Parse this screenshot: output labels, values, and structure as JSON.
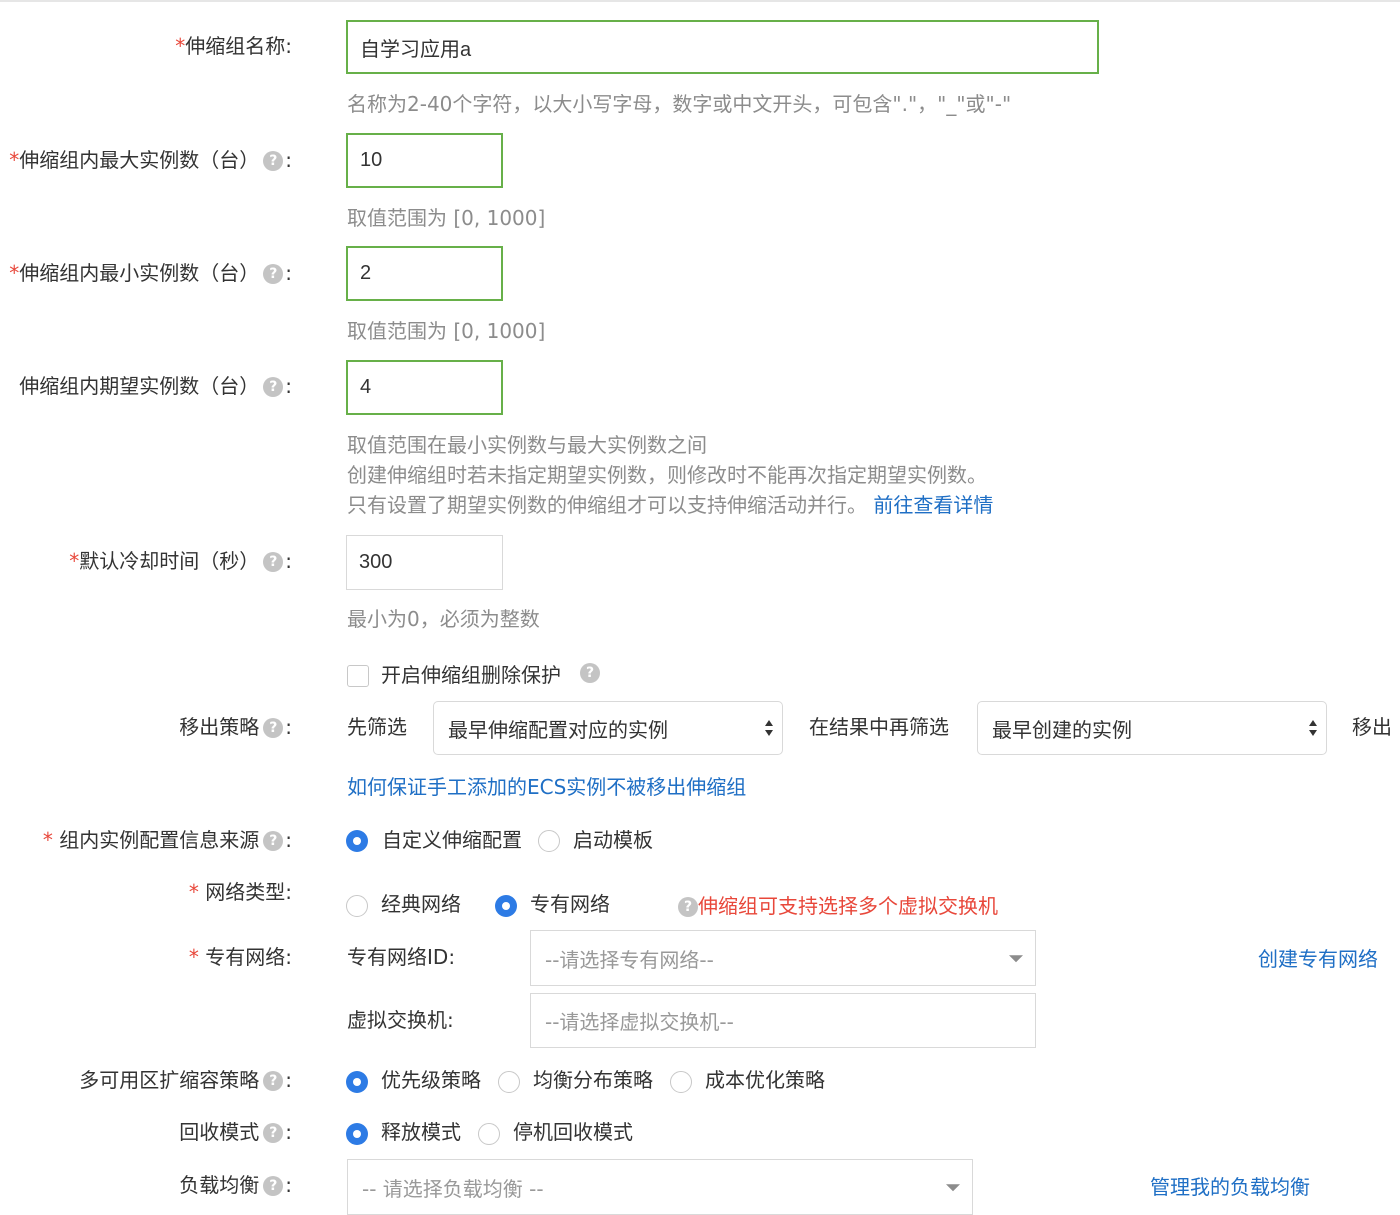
{
  "form": {
    "name": {
      "label": "伸缩组名称",
      "value": "自学习应用a",
      "help": "名称为2-40个字符，以大小写字母，数字或中文开头，可包含\".\"，\"_\"或\"-\""
    },
    "max_instances": {
      "label": "伸缩组内最大实例数（台）",
      "value": "10",
      "help": "取值范围为 [0, 1000]"
    },
    "min_instances": {
      "label": "伸缩组内最小实例数（台）",
      "value": "2",
      "help": "取值范围为 [0, 1000]"
    },
    "desired_instances": {
      "label": "伸缩组内期望实例数（台）",
      "value": "4",
      "help_line1": "取值范围在最小实例数与最大实例数之间",
      "help_line2": "创建伸缩组时若未指定期望实例数，则修改时不能再次指定期望实例数。",
      "help_line3": "只有设置了期望实例数的伸缩组才可以支持伸缩活动并行。",
      "help_link": "前往查看详情"
    },
    "cooldown": {
      "label": "默认冷却时间（秒）",
      "value": "300",
      "help": "最小为0，必须为整数"
    },
    "delete_protection": {
      "label": "开启伸缩组删除保护",
      "checked": false
    },
    "removal_policy": {
      "label": "移出策略",
      "first_filter_label": "先筛选",
      "first_filter_value": "最早伸缩配置对应的实例",
      "second_filter_label": "在结果中再筛选",
      "second_filter_value": "最早创建的实例",
      "suffix": "移出",
      "link": "如何保证手工添加的ECS实例不被移出伸缩组"
    },
    "config_source": {
      "label": "组内实例配置信息来源",
      "options": [
        "自定义伸缩配置",
        "启动模板"
      ],
      "selected": "自定义伸缩配置"
    },
    "network_type": {
      "label": "网络类型",
      "options": [
        "经典网络",
        "专有网络"
      ],
      "selected": "专有网络",
      "hint": "伸缩组可支持选择多个虚拟交换机"
    },
    "vpc": {
      "label": "专有网络",
      "vpc_id_label": "专有网络ID",
      "vpc_id_placeholder": "--请选择专有网络--",
      "vswitch_label": "虚拟交换机",
      "vswitch_placeholder": "--请选择虚拟交换机--",
      "create_link": "创建专有网络"
    },
    "multi_zone_policy": {
      "label": "多可用区扩缩容策略",
      "options": [
        "优先级策略",
        "均衡分布策略",
        "成本优化策略"
      ],
      "selected": "优先级策略"
    },
    "reclaim_mode": {
      "label": "回收模式",
      "options": [
        "释放模式",
        "停机回收模式"
      ],
      "selected": "释放模式"
    },
    "load_balancer": {
      "label": "负载均衡",
      "placeholder": "-- 请选择负载均衡 --",
      "manage_link": "管理我的负载均衡"
    }
  },
  "colors": {
    "accent": "#2d7be5",
    "link": "#1f6fc5",
    "required": "#e8473a",
    "focus_border": "#67b049"
  }
}
